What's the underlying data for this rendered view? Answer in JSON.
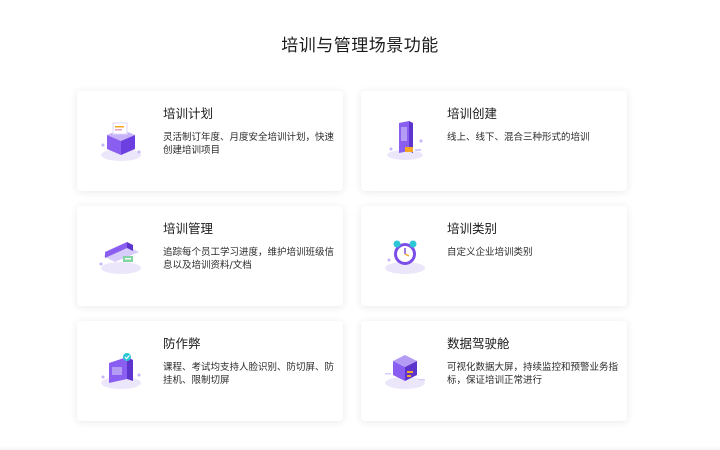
{
  "page": {
    "title": "培训与管理场景功能"
  },
  "cards": [
    {
      "icon": "box-icon",
      "title": "培训计划",
      "desc": "灵活制订年度、月度安全培训计划，快速创建培训项目"
    },
    {
      "icon": "phone-icon",
      "title": "培训创建",
      "desc": "线上、线下、混合三种形式的培训"
    },
    {
      "icon": "card-icon",
      "title": "培训管理",
      "desc": "追踪每个员工学习进度，维护培训班级信息以及培训资料/文档"
    },
    {
      "icon": "clock-icon",
      "title": "培训类别",
      "desc": "自定义企业培训类别"
    },
    {
      "icon": "shield-icon",
      "title": "防作弊",
      "desc": "课程、考试均支持人脸识别、防切屏、防挂机、限制切屏"
    },
    {
      "icon": "cube-icon",
      "title": "数据驾驶舱",
      "desc": "可视化数据大屏，持续监控和预警业务指标，保证培训正常进行"
    }
  ],
  "colors": {
    "accent": "#7b4ee8",
    "accent_light": "#b49cf5",
    "teal": "#2fc6d6",
    "orange": "#f5a623"
  }
}
